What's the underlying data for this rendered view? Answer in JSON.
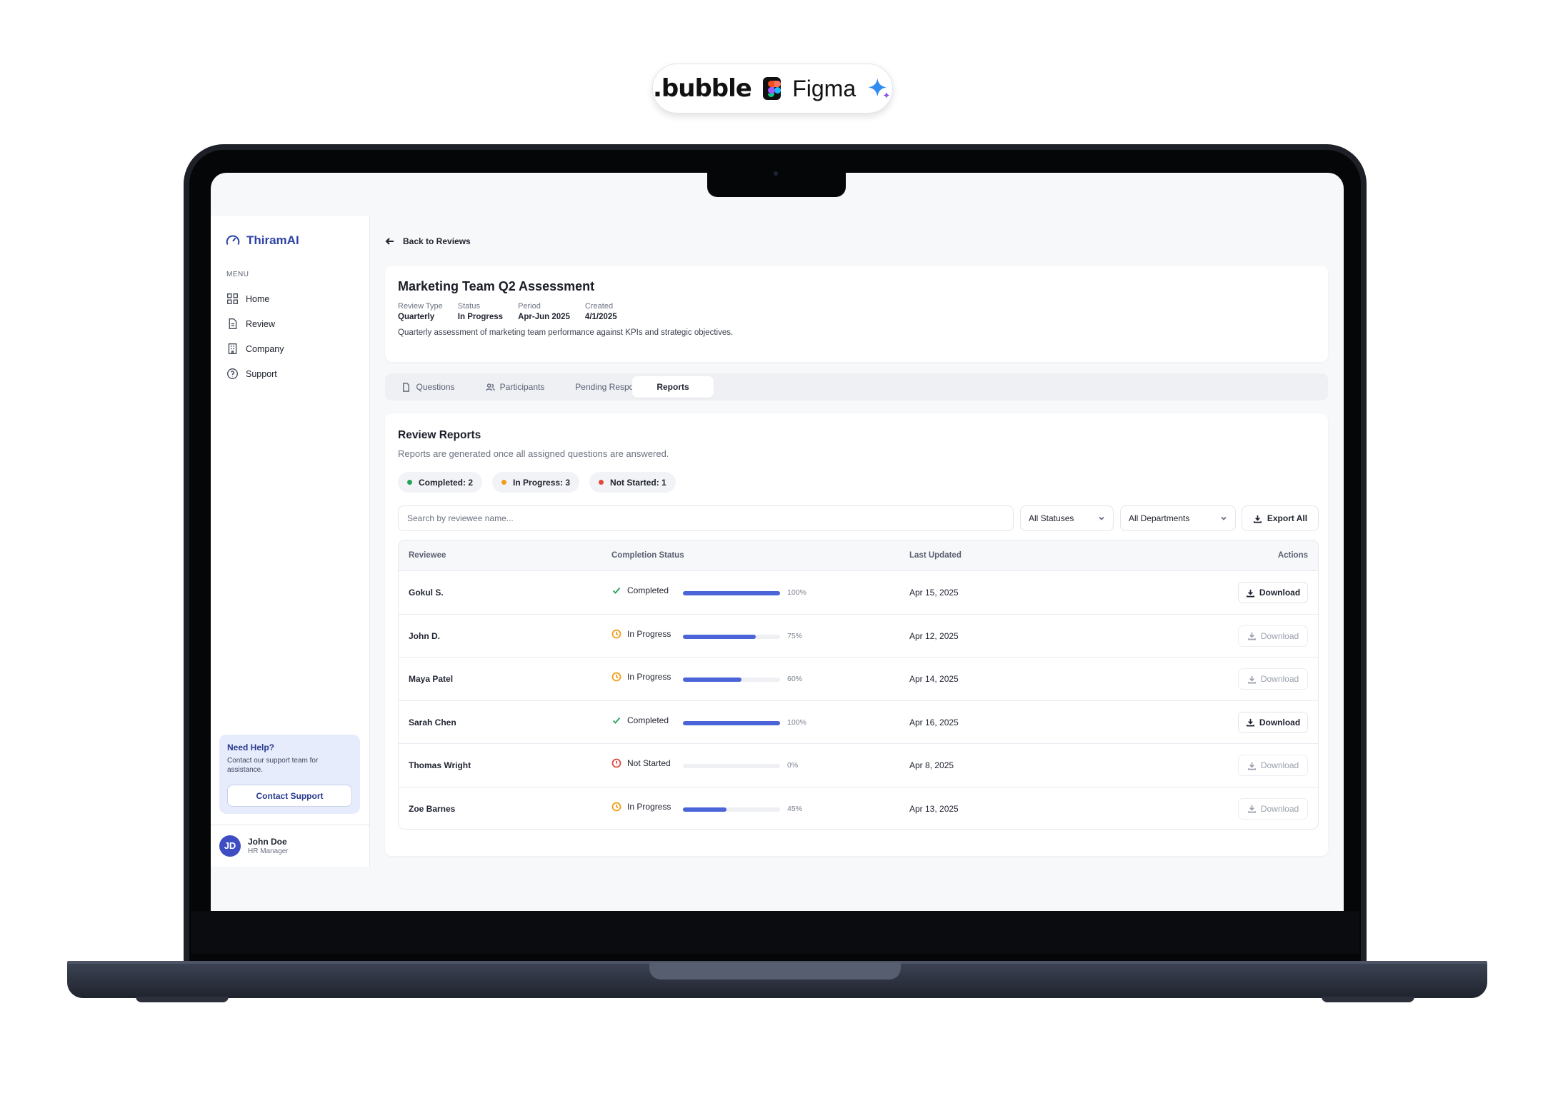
{
  "brand_pill": {
    "bubble": ".bubble",
    "figma": "Figma",
    "icons": [
      "figma-icon",
      "sparkle-icon"
    ]
  },
  "colors": {
    "accent": "#2d43a6",
    "progress": "#4b64d8",
    "completed": "#22a555",
    "in_progress": "#f29d1a",
    "not_started": "#e0483e"
  },
  "app": {
    "logo_text": "ThiramAI",
    "menu_label": "MENU",
    "nav": [
      {
        "label": "Home",
        "icon": "grid-icon"
      },
      {
        "label": "Review",
        "icon": "document-icon"
      },
      {
        "label": "Company",
        "icon": "building-icon"
      },
      {
        "label": "Support",
        "icon": "help-circle-icon"
      }
    ],
    "help": {
      "title": "Need Help?",
      "text": "Contact our support team for assistance.",
      "button": "Contact Support"
    },
    "user": {
      "initials": "JD",
      "name": "John Doe",
      "role": "HR Manager"
    }
  },
  "back_label": "Back to Reviews",
  "review": {
    "title": "Marketing Team Q2 Assessment",
    "meta": [
      {
        "key": "Review Type",
        "value": "Quarterly"
      },
      {
        "key": "Status",
        "value": "In Progress"
      },
      {
        "key": "Period",
        "value": "Apr-Jun 2025"
      },
      {
        "key": "Created",
        "value": "4/1/2025"
      }
    ],
    "description": "Quarterly assessment of marketing team performance against KPIs and strategic objectives."
  },
  "tabs": [
    {
      "label": "Questions",
      "active": false
    },
    {
      "label": "Participants",
      "active": false
    },
    {
      "label": "Pending Responses",
      "active": false
    },
    {
      "label": "Reports",
      "active": true
    }
  ],
  "reports": {
    "title": "Review Reports",
    "subtitle": "Reports are generated once all assigned questions are answered.",
    "badges": [
      {
        "label": "Completed: 2",
        "status": "completed"
      },
      {
        "label": "In Progress: 3",
        "status": "in_progress"
      },
      {
        "label": "Not Started: 1",
        "status": "not_started"
      }
    ],
    "search_placeholder": "Search by reviewee name...",
    "filter_status": "All Statuses",
    "filter_department": "All Departments",
    "export_label": "Export All",
    "columns": [
      "Reviewee",
      "Completion Status",
      "Last Updated",
      "Actions"
    ],
    "rows": [
      {
        "name": "Gokul S.",
        "status": "Completed",
        "status_key": "completed",
        "progress": 100,
        "progress_label": "100%",
        "updated": "Apr 15, 2025",
        "action": "Download",
        "enabled": true
      },
      {
        "name": "John D.",
        "status": "In Progress",
        "status_key": "in_progress",
        "progress": 75,
        "progress_label": "75%",
        "updated": "Apr 12, 2025",
        "action": "Download",
        "enabled": false
      },
      {
        "name": "Maya Patel",
        "status": "In Progress",
        "status_key": "in_progress",
        "progress": 60,
        "progress_label": "60%",
        "updated": "Apr 14, 2025",
        "action": "Download",
        "enabled": false
      },
      {
        "name": "Sarah Chen",
        "status": "Completed",
        "status_key": "completed",
        "progress": 100,
        "progress_label": "100%",
        "updated": "Apr 16, 2025",
        "action": "Download",
        "enabled": true
      },
      {
        "name": "Thomas Wright",
        "status": "Not Started",
        "status_key": "not_started",
        "progress": 0,
        "progress_label": "0%",
        "updated": "Apr 8, 2025",
        "action": "Download",
        "enabled": false
      },
      {
        "name": "Zoe Barnes",
        "status": "In Progress",
        "status_key": "in_progress",
        "progress": 45,
        "progress_label": "45%",
        "updated": "Apr 13, 2025",
        "action": "Download",
        "enabled": false
      }
    ]
  }
}
